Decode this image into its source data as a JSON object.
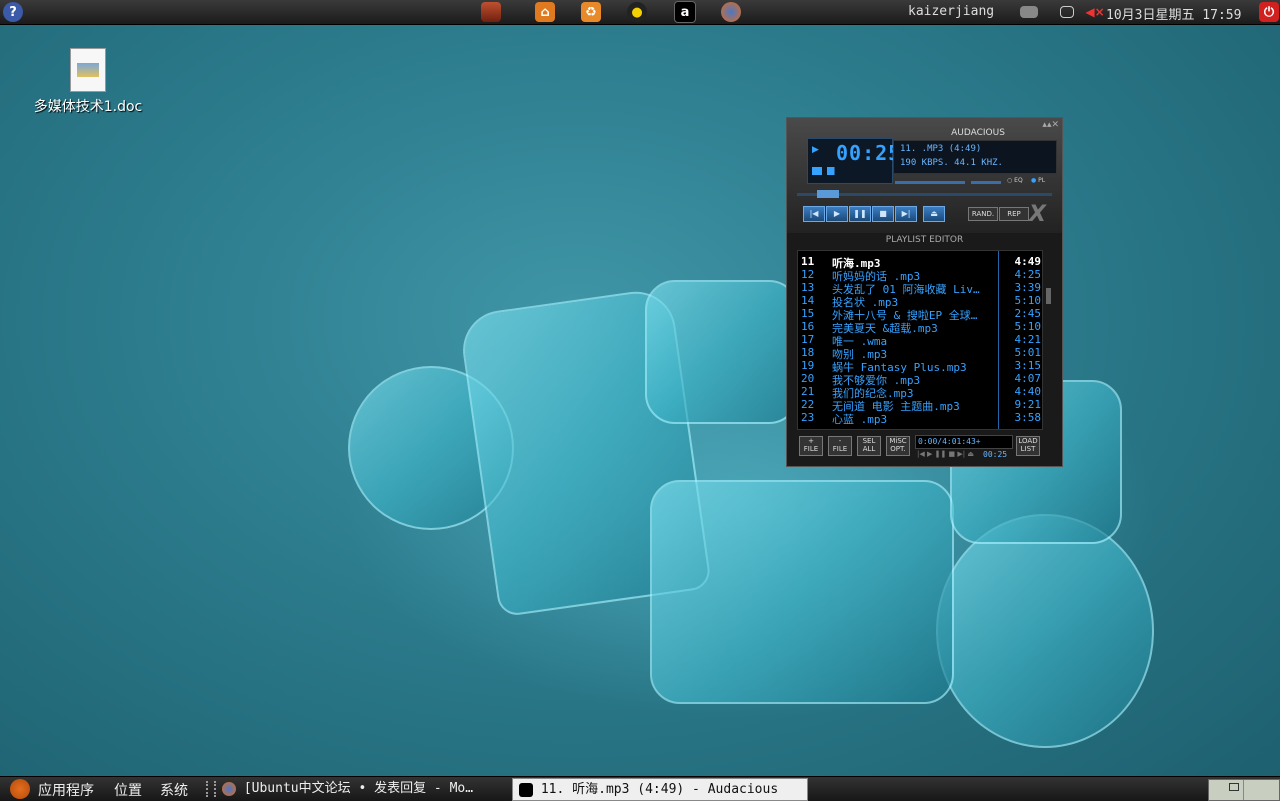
{
  "top_panel": {
    "launchers": [
      {
        "icon": "help-icon",
        "color": "#3b5aa8"
      },
      {
        "icon": "desktop-icon",
        "color": "#b04020"
      },
      {
        "icon": "home-folder-icon",
        "color": "#e07a20"
      },
      {
        "icon": "trash-icon",
        "color": "#e88a2a"
      },
      {
        "icon": "qq-icon",
        "color": "#f5d000"
      },
      {
        "icon": "audacious-icon",
        "color": "#000000"
      },
      {
        "icon": "firefox-icon",
        "color": "#e06a1a"
      }
    ],
    "username": "kaizerjiang",
    "datetime": "10月3日星期五 17:59"
  },
  "desktop": {
    "icon_label": "多媒体技术1.doc"
  },
  "audacious": {
    "title": "AUDACIOUS",
    "time": "00:25",
    "track_line": "11.   .MP3 (4:49)",
    "bitrate_line": "190 KBPS. 44.1 KHZ.",
    "eq_label": "EQ",
    "pl_label": "PL",
    "rand_label": "RAND.",
    "rep_label": "REP",
    "playlist_title": "PLAYLIST EDITOR",
    "tracks": [
      {
        "num": "11",
        "name": "听海.mp3",
        "dur": "4:49"
      },
      {
        "num": "12",
        "name": "听妈妈的话 .mp3",
        "dur": "4:25"
      },
      {
        "num": "13",
        "name": "头发乱了 01 阿海收藏 Liv…",
        "dur": "3:39"
      },
      {
        "num": "14",
        "name": "投名状 .mp3",
        "dur": "5:10"
      },
      {
        "num": "15",
        "name": "外滩十八号 & 搜啦EP 全球…",
        "dur": "2:45"
      },
      {
        "num": "16",
        "name": "完美夏天 &超载.mp3",
        "dur": "5:10"
      },
      {
        "num": "17",
        "name": "唯一 .wma",
        "dur": "4:21"
      },
      {
        "num": "18",
        "name": "吻别 .mp3",
        "dur": "5:01"
      },
      {
        "num": "19",
        "name": "蜗牛 Fantasy Plus.mp3",
        "dur": "3:15"
      },
      {
        "num": "20",
        "name": "我不够爱你 .mp3",
        "dur": "4:07"
      },
      {
        "num": "21",
        "name": "我们的纪念.mp3",
        "dur": "4:40"
      },
      {
        "num": "22",
        "name": "无间道 电影 主题曲.mp3",
        "dur": "9:21"
      },
      {
        "num": "23",
        "name": "心蓝 .mp3",
        "dur": "3:58"
      }
    ],
    "footer_buttons": [
      {
        "top": "+",
        "bottom": "FILE"
      },
      {
        "top": "-",
        "bottom": "FILE"
      },
      {
        "top": "SEL",
        "bottom": "ALL"
      },
      {
        "top": "MiSC",
        "bottom": "OPT."
      }
    ],
    "load_list": {
      "top": "LOAD",
      "bottom": "LIST"
    },
    "mini_display": "0:00/4:01:43+",
    "mini_time": "00:25"
  },
  "bottom_panel": {
    "menus": [
      "应用程序",
      "位置",
      "系统"
    ],
    "tasks": [
      {
        "label": "[Ubuntu中文论坛 • 发表回复 - Mo…",
        "active": false
      },
      {
        "label": "11. 听海.mp3 (4:49) - Audacious",
        "active": true
      }
    ]
  }
}
